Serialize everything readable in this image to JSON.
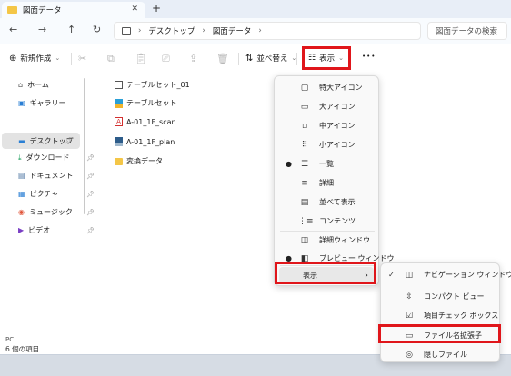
{
  "window": {
    "tab_title": "図面データ",
    "tab_close": "✕",
    "new_tab": "+"
  },
  "nav": {
    "back": "←",
    "forward": "→",
    "up": "↑",
    "refresh": "↻"
  },
  "address": {
    "chevron": "›",
    "crumbs": [
      "デスクトップ",
      "図面データ"
    ],
    "search_placeholder": "図面データの検索"
  },
  "toolbar": {
    "new_label": "新規作成",
    "sort_label": "並べ替え",
    "view_label": "表示",
    "more_label": "•••",
    "chevron": "⌄"
  },
  "sidebar": {
    "items": [
      {
        "label": "ホーム",
        "pinned": false
      },
      {
        "label": "ギャラリー",
        "pinned": false
      },
      {
        "label": "デスクトップ",
        "pinned": true
      },
      {
        "label": "ダウンロード",
        "pinned": true
      },
      {
        "label": "ドキュメント",
        "pinned": true
      },
      {
        "label": "ピクチャ",
        "pinned": true
      },
      {
        "label": "ミュージック",
        "pinned": true
      },
      {
        "label": "ビデオ",
        "pinned": true
      }
    ],
    "bottom_item": "PC"
  },
  "files": [
    {
      "name": "テーブルセット_01",
      "type": "image"
    },
    {
      "name": "テーブルセット",
      "type": "table"
    },
    {
      "name": "A-01_1F_scan",
      "type": "pdf"
    },
    {
      "name": "A-01_1F_plan",
      "type": "cad"
    },
    {
      "name": "変換データ",
      "type": "folder"
    }
  ],
  "status": {
    "count": "6 個の項目"
  },
  "view_menu": {
    "items": [
      {
        "label": "特大アイコン",
        "icon": "▢"
      },
      {
        "label": "大アイコン",
        "icon": "▭"
      },
      {
        "label": "中アイコン",
        "icon": "▫"
      },
      {
        "label": "小アイコン",
        "icon": "⠿"
      },
      {
        "label": "一覧",
        "icon": "☰"
      },
      {
        "label": "詳細",
        "icon": "≡"
      },
      {
        "label": "並べて表示",
        "icon": "▤"
      },
      {
        "label": "コンテンツ",
        "icon": "⋮≡"
      },
      {
        "label": "詳細ウィンドウ",
        "icon": "◫"
      },
      {
        "label": "プレビュー ウィンドウ",
        "icon": "◧"
      },
      {
        "label": "表示",
        "icon": ""
      }
    ],
    "selected_layout": "一覧",
    "selected_pane": "プレビュー ウィンドウ",
    "submenu_arrow": "›"
  },
  "show_submenu": {
    "items": [
      {
        "label": "ナビゲーション ウィンドウ",
        "icon": "◫",
        "checked": true
      },
      {
        "label": "コンパクト ビュー",
        "icon": "⇳",
        "checked": false
      },
      {
        "label": "項目チェック ボックス",
        "icon": "☑",
        "checked": false
      },
      {
        "label": "ファイル名拡張子",
        "icon": "▭",
        "checked": false
      },
      {
        "label": "隠しファイル",
        "icon": "◎",
        "checked": false
      }
    ]
  },
  "colors": {
    "highlight_border": "#e0161b",
    "folder": "#f4c647"
  }
}
